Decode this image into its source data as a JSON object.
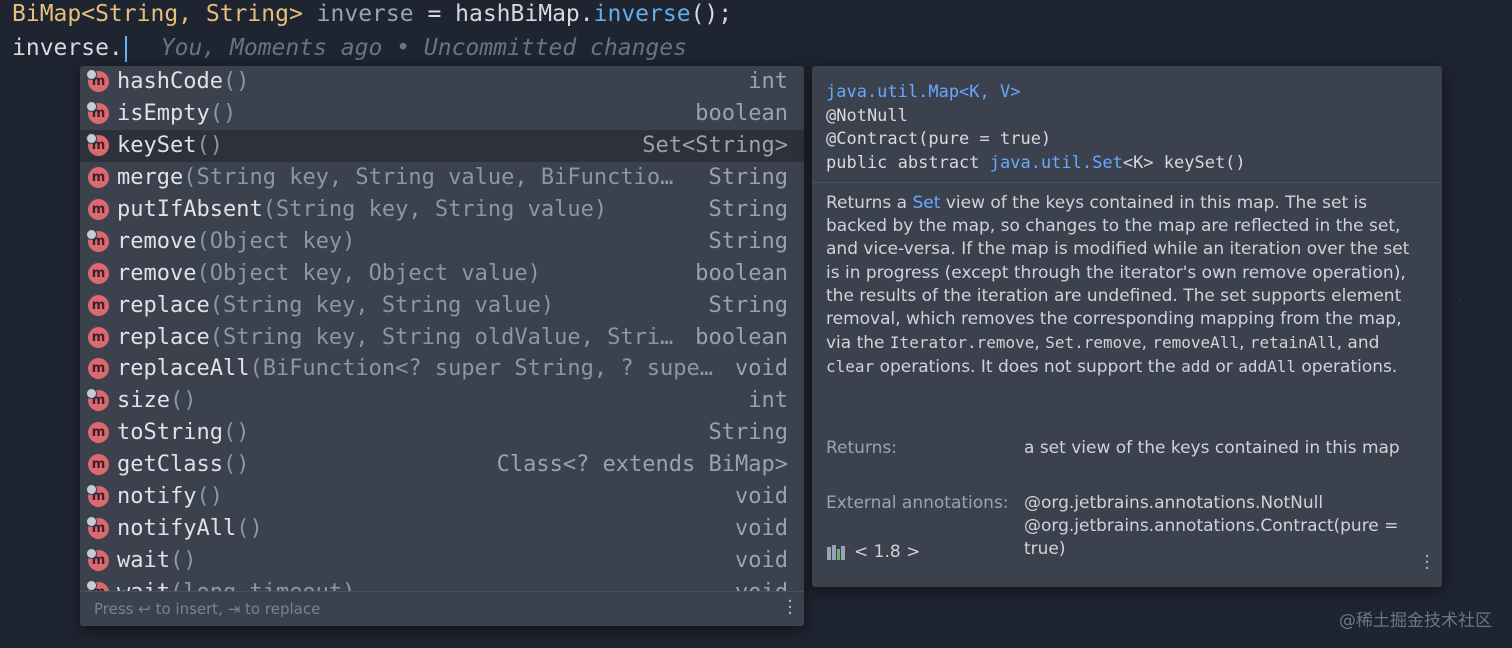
{
  "editor": {
    "line1": {
      "type": "BiMap<String, String>",
      "var": "inverse",
      "op": " = ",
      "obj": "hashBiMap.",
      "method": "inverse",
      "end": "();"
    },
    "line2": {
      "text": "inverse.",
      "blame": "You, Moments ago • Uncommitted changes"
    }
  },
  "completion": {
    "items": [
      {
        "name": "hashCode",
        "params": "()",
        "type": "int",
        "inherited": true
      },
      {
        "name": "isEmpty",
        "params": "()",
        "type": "boolean",
        "inherited": true
      },
      {
        "name": "keySet",
        "params": "()",
        "type": "Set<String>",
        "inherited": true,
        "selected": true
      },
      {
        "name": "merge",
        "params": "(String key, String value, BiFunction…",
        "type": "String",
        "inherited": false
      },
      {
        "name": "putIfAbsent",
        "params": "(String key, String value)",
        "type": "String",
        "inherited": false
      },
      {
        "name": "remove",
        "params": "(Object key)",
        "type": "String",
        "inherited": true
      },
      {
        "name": "remove",
        "params": "(Object key, Object value)",
        "type": "boolean",
        "inherited": false
      },
      {
        "name": "replace",
        "params": "(String key, String value)",
        "type": "String",
        "inherited": false
      },
      {
        "name": "replace",
        "params": "(String key, String oldValue, Stri…",
        "type": "boolean",
        "inherited": false
      },
      {
        "name": "replaceAll",
        "params": "(BiFunction<? super String, ? supe…",
        "type": "void",
        "inherited": false
      },
      {
        "name": "size",
        "params": "()",
        "type": "int",
        "inherited": true
      },
      {
        "name": "toString",
        "params": "()",
        "type": "String",
        "inherited": false
      },
      {
        "name": "getClass",
        "params": "()",
        "type": "Class<? extends BiMap>",
        "inherited": false
      },
      {
        "name": "notify",
        "params": "()",
        "type": "void",
        "inherited": true
      },
      {
        "name": "notifyAll",
        "params": "()",
        "type": "void",
        "inherited": true
      },
      {
        "name": "wait",
        "params": "()",
        "type": "void",
        "inherited": true
      },
      {
        "name": "wait",
        "params": "(long timeout)",
        "type": "void",
        "inherited": true
      }
    ],
    "hint": "Press ↩ to insert, ⇥ to replace"
  },
  "doc": {
    "sig_line1": "java.util.Map<K, V>",
    "sig_line2": "@NotNull",
    "sig_line3": "@Contract(pure = true)",
    "sig_line4_pre": "public abstract ",
    "sig_line4_type": "java.util.Set",
    "sig_line4_post": "<K> keySet()",
    "body": {
      "p1": "Returns a ",
      "set_link": "Set",
      "p2": " view of the keys contained in this map. The set is backed by the map, so changes to the map are reflected in the set, and vice-versa. If the map is modified while an iteration over the set is in progress (except through the iterator's own remove operation), the results of the iteration are undefined. The set supports element removal, which removes the corresponding mapping from the map, via the ",
      "c1": "Iterator.remove",
      "s1": ", ",
      "c2": "Set.remove",
      "s2": ", ",
      "c3": "removeAll",
      "s3": ", ",
      "c4": "retainAll",
      "s4": ", and ",
      "c5": "clear",
      "s5": " operations. It does not support the ",
      "c6": "add",
      "s6": " or ",
      "c7": "addAll",
      "s7": " operations."
    },
    "returns_label": "Returns:",
    "returns_value": "a set view of the keys contained in this map",
    "ext_label": "External annotations:",
    "ext_value": "@org.jetbrains.annotations.NotNull @org.jetbrains.annotations.Contract(pure = true)",
    "version": "< 1.8 >"
  },
  "watermark": "@稀土掘金技术社区"
}
